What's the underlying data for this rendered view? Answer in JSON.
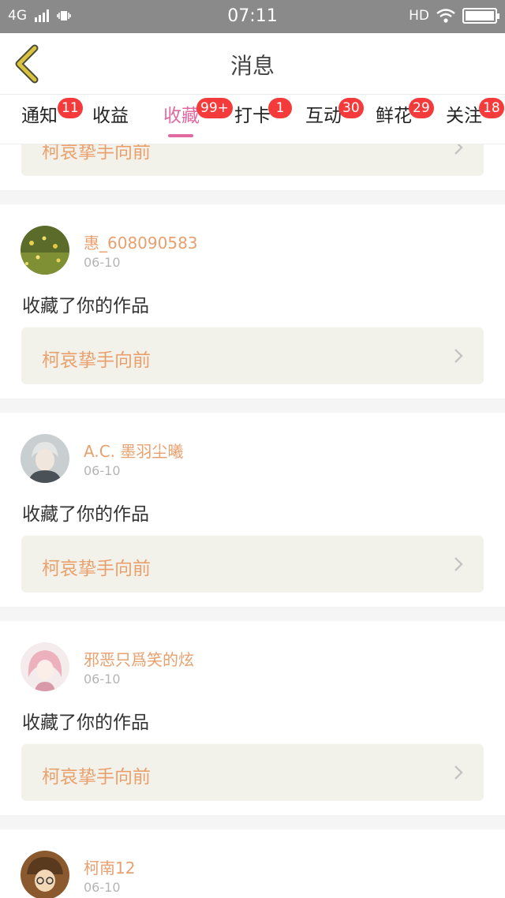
{
  "status_bar": {
    "network": "4G",
    "time": "07:11",
    "hd": "HD"
  },
  "header": {
    "title": "消息"
  },
  "tabs": [
    {
      "label": "通知",
      "badge": "11"
    },
    {
      "label": "收益",
      "badge": ""
    },
    {
      "label": "收藏",
      "badge": "99+",
      "active": true
    },
    {
      "label": "打卡",
      "badge": "1"
    },
    {
      "label": "互动",
      "badge": "30"
    },
    {
      "label": "鲜花",
      "badge": "29"
    },
    {
      "label": "关注",
      "badge": "18"
    }
  ],
  "feed": {
    "partial_top": {
      "work_title": "柯哀挚手向前"
    },
    "items": [
      {
        "user": "惠_608090583",
        "date": "06-10",
        "action": "收藏了你的作品",
        "work_title": "柯哀挚手向前",
        "avatar": "flower-field-avatar"
      },
      {
        "user": "A.C. 墨羽尘曦",
        "date": "06-10",
        "action": "收藏了你的作品",
        "work_title": "柯哀挚手向前",
        "avatar": "anime-boy-avatar"
      },
      {
        "user": "邪恶只爲笑的炫",
        "date": "06-10",
        "action": "收藏了你的作品",
        "work_title": "柯哀挚手向前",
        "avatar": "pink-hair-girl-avatar"
      },
      {
        "user": "柯南12",
        "date": "06-10",
        "action": "",
        "work_title": "",
        "avatar": "detective-avatar"
      }
    ]
  },
  "colors": {
    "accent_pink": "#e06aa0",
    "username_orange": "#e8a06e",
    "badge_red": "#f43a3a",
    "back_arrow": "#d9c23e"
  }
}
